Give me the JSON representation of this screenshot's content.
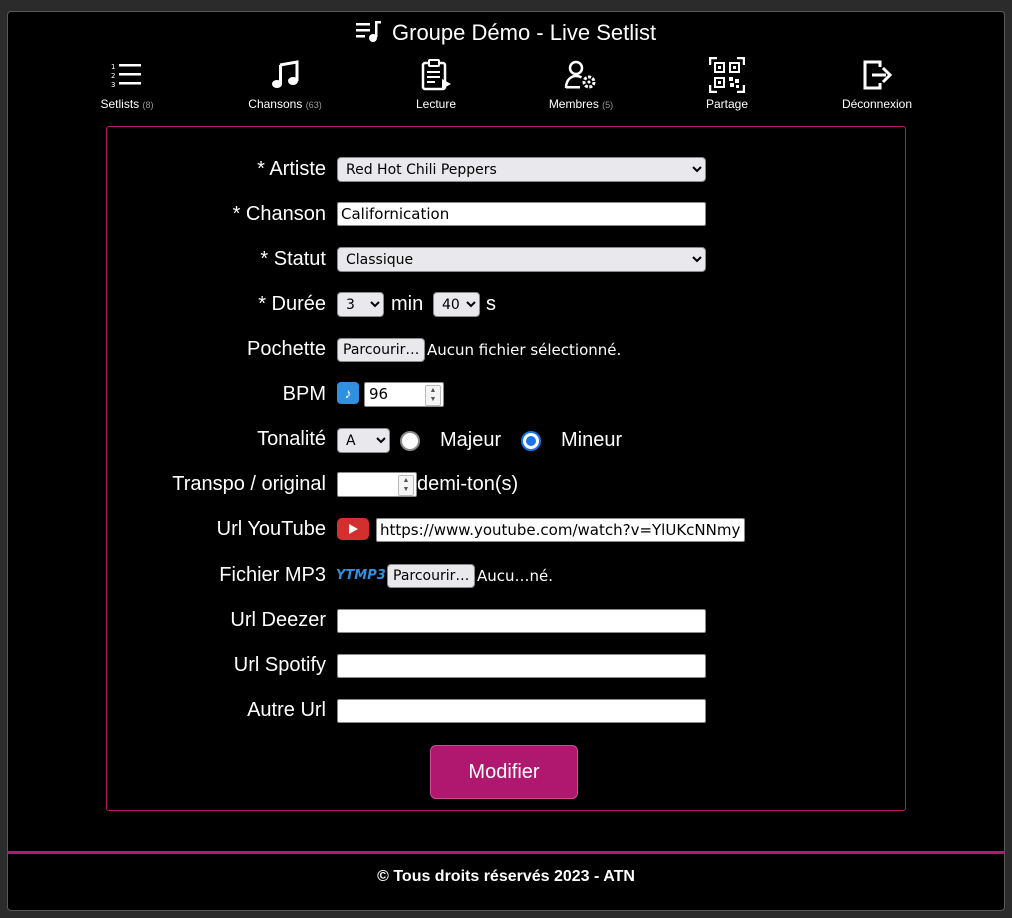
{
  "header": {
    "title": "Groupe Démo - Live Setlist"
  },
  "nav": [
    {
      "label": "Setlists",
      "count": "(8)",
      "icon": "numbered-list-icon"
    },
    {
      "label": "Chansons",
      "count": "(63)",
      "icon": "music-note-icon"
    },
    {
      "label": "Lecture",
      "count": "",
      "icon": "clipboard-play-icon"
    },
    {
      "label": "Membres",
      "count": "(5)",
      "icon": "user-gear-icon"
    },
    {
      "label": "Partage",
      "count": "",
      "icon": "qr-code-icon"
    },
    {
      "label": "Déconnexion",
      "count": "",
      "icon": "logout-icon"
    }
  ],
  "form": {
    "artist_label": "* Artiste",
    "artist_value": "Red Hot Chili Peppers",
    "song_label": "* Chanson",
    "song_value": "Californication",
    "status_label": "* Statut",
    "status_value": "Classique",
    "duration_label": "* Durée",
    "duration_min": "3",
    "duration_min_unit": "min",
    "duration_sec": "40",
    "duration_sec_unit": "s",
    "cover_label": "Pochette",
    "cover_button": "Parcourir…",
    "cover_status": "Aucun fichier sélectionné.",
    "bpm_label": "BPM",
    "bpm_value": "96",
    "key_label": "Tonalité",
    "key_value": "A",
    "major_label": "Majeur",
    "minor_label": "Mineur",
    "transpo_label": "Transpo / original",
    "transpo_value": "",
    "transpo_unit": "demi-ton(s)",
    "youtube_label": "Url YouTube",
    "youtube_value": "https://www.youtube.com/watch?v=YlUKcNNmywk",
    "mp3_label": "Fichier MP3",
    "mp3_icon_text": "YTMP3",
    "mp3_button": "Parcourir…",
    "mp3_status": "Aucu…né.",
    "deezer_label": "Url Deezer",
    "deezer_value": "",
    "spotify_label": "Url Spotify",
    "spotify_value": "",
    "other_label": "Autre Url",
    "other_value": "",
    "submit_label": "Modifier"
  },
  "footer": {
    "text": "© Tous droits réservés 2023 - ATN"
  },
  "colors": {
    "accent": "#b5186f",
    "background": "#000000",
    "selected_radio": "#1a73e8"
  }
}
